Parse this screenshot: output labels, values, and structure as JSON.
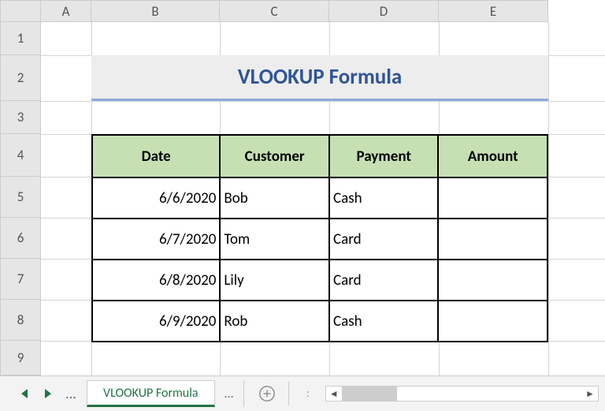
{
  "columns": [
    "A",
    "B",
    "C",
    "D",
    "E"
  ],
  "rows": [
    "1",
    "2",
    "3",
    "4",
    "5",
    "6",
    "7",
    "8",
    "9"
  ],
  "title": "VLOOKUP Formula",
  "table": {
    "headers": [
      "Date",
      "Customer",
      "Payment",
      "Amount"
    ],
    "rows": [
      {
        "date": "6/6/2020",
        "customer": "Bob",
        "payment": "Cash",
        "amount": ""
      },
      {
        "date": "6/7/2020",
        "customer": "Tom",
        "payment": "Card",
        "amount": ""
      },
      {
        "date": "6/8/2020",
        "customer": "Lily",
        "payment": "Card",
        "amount": ""
      },
      {
        "date": "6/9/2020",
        "customer": "Rob",
        "payment": "Cash",
        "amount": ""
      }
    ]
  },
  "tabs": {
    "active": "VLOOKUP Formula",
    "ellipsis": "..."
  },
  "nav": {
    "dots": ":"
  },
  "chart_data": {
    "type": "table",
    "title": "VLOOKUP Formula",
    "columns": [
      "Date",
      "Customer",
      "Payment",
      "Amount"
    ],
    "rows": [
      [
        "6/6/2020",
        "Bob",
        "Cash",
        ""
      ],
      [
        "6/7/2020",
        "Tom",
        "Card",
        ""
      ],
      [
        "6/8/2020",
        "Lily",
        "Card",
        ""
      ],
      [
        "6/9/2020",
        "Rob",
        "Cash",
        ""
      ]
    ]
  }
}
